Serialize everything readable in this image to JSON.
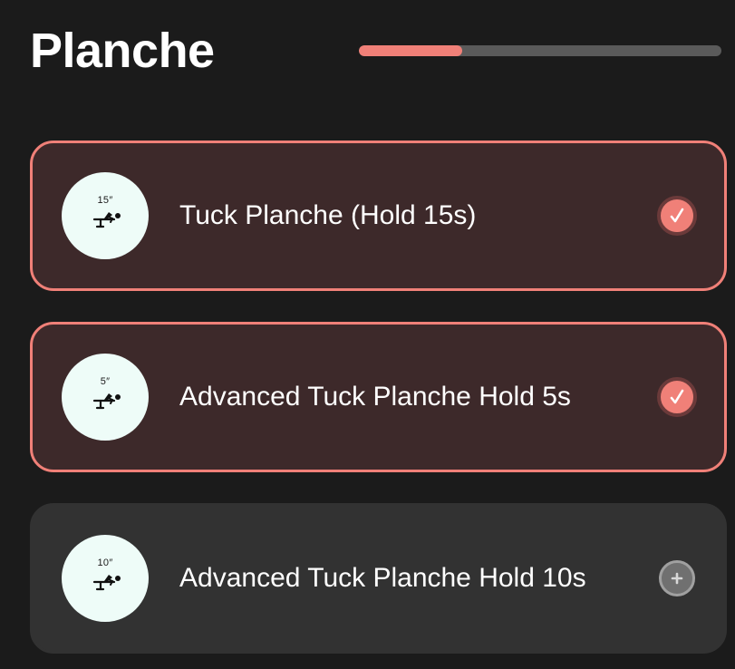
{
  "header": {
    "title": "Planche",
    "progress": 0.285
  },
  "exercises": [
    {
      "time": "15″",
      "label": "Tuck Planche (Hold 15s)",
      "done": true,
      "status_icon": "check-icon"
    },
    {
      "time": "5″",
      "label": "Advanced Tuck Planche Hold 5s",
      "done": true,
      "status_icon": "check-icon"
    },
    {
      "time": "10″",
      "label": "Advanced Tuck Planche Hold 10s",
      "done": false,
      "status_icon": "plus-icon"
    }
  ],
  "colors": {
    "accent": "#f08078",
    "background": "#1b1b1b",
    "done_card": "#3d292a",
    "todo_card": "#323232",
    "thumb_bg": "#eefcf8"
  }
}
